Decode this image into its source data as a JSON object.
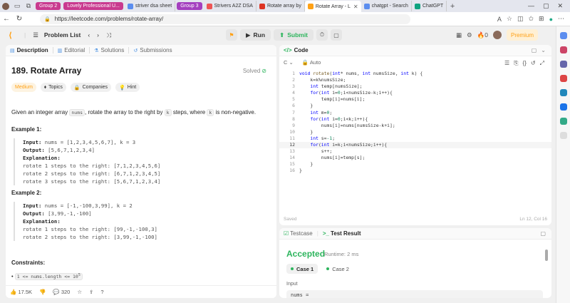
{
  "browser": {
    "tabs": [
      {
        "kind": "group",
        "label": "Group 2",
        "color": "#c93a8f"
      },
      {
        "kind": "group",
        "label": "Lovely Professional U...",
        "color": "#c93a8f"
      },
      {
        "kind": "tab",
        "label": "striver dsa sheet",
        "fav": "#5b8def"
      },
      {
        "kind": "group",
        "label": "Group 3",
        "color": "#a43fbf"
      },
      {
        "kind": "tab",
        "label": "Strivers A2Z DSA",
        "fav": "#e55"
      },
      {
        "kind": "tab",
        "label": "Rotate array by",
        "fav": "#d32"
      },
      {
        "kind": "tab",
        "label": "Rotate Array - L",
        "fav": "#ffa116",
        "active": true
      },
      {
        "kind": "tab",
        "label": "chatgpt - Search",
        "fav": "#5b8def"
      },
      {
        "kind": "tab",
        "label": "ChatGPT",
        "fav": "#10a37f"
      }
    ],
    "new_tab": "+",
    "url": "https://leetcode.com/problems/rotate-array/"
  },
  "header": {
    "problem_list": "Problem List",
    "run": "Run",
    "submit": "Submit",
    "streak": "0",
    "premium": "Premium"
  },
  "left": {
    "tabs": [
      "Description",
      "Editorial",
      "Solutions",
      "Submissions"
    ],
    "title": "189. Rotate Array",
    "solved": "Solved",
    "chips": {
      "difficulty": "Medium",
      "topics": "Topics",
      "companies": "Companies",
      "hint": "Hint"
    },
    "desc": {
      "a": "Given an integer array",
      "b": "nums",
      "c": ", rotate the array to the right by",
      "d": "k",
      "e": "steps, where",
      "f": "k",
      "g": "is non-negative."
    },
    "example1": {
      "heading": "Example 1:",
      "input_label": "Input:",
      "input": "nums = [1,2,3,4,5,6,7], k = 3",
      "output_label": "Output:",
      "output": "[5,6,7,1,2,3,4]",
      "explanation_label": "Explanation:",
      "lines": [
        "rotate 1 steps to the right: [7,1,2,3,4,5,6]",
        "rotate 2 steps to the right: [6,7,1,2,3,4,5]",
        "rotate 3 steps to the right: [5,6,7,1,2,3,4]"
      ]
    },
    "example2": {
      "heading": "Example 2:",
      "input_label": "Input:",
      "input": "nums = [-1,-100,3,99], k = 2",
      "output_label": "Output:",
      "output": "[3,99,-1,-100]",
      "explanation_label": "Explanation:",
      "lines": [
        "rotate 1 steps to the right: [99,-1,-100,3]",
        "rotate 2 steps to the right: [3,99,-1,-100]"
      ]
    },
    "constraints_heading": "Constraints:",
    "constraint1": "1 <= nums.length <= 10",
    "constraint1_sup": "5",
    "footer": {
      "likes": "17.5K",
      "comments": "320"
    }
  },
  "code": {
    "title": "Code",
    "language": "C",
    "mode": "Auto",
    "lines": [
      "void rotate(int* nums, int numsSize, int k) {",
      "    k=k%numsSize;",
      "    int temp[numsSize];",
      "    for(int i=0;i<numsSize-k;i++){",
      "        temp[i]=nums[i];",
      "    }",
      "    int m=0;",
      "    for(int i=0;i<k;i++){",
      "        nums[i]=nums[numsSize-k+i];",
      "    }",
      "    int s=-1;",
      "    for(int i=k;i<numsSize;i++){",
      "        s++;",
      "        nums[i]=temp[s];",
      "    }",
      "}"
    ],
    "current_line": 12,
    "saved": "Saved",
    "position": "Ln 12, Col 16"
  },
  "result": {
    "tab_testcase": "Testcase",
    "tab_result": "Test Result",
    "status": "Accepted",
    "runtime": "Runtime: 2 ms",
    "cases": [
      "Case 1",
      "Case 2"
    ],
    "input_label": "Input",
    "input_value": "nums ="
  },
  "colors": {
    "brand": "#ffa116",
    "accepted": "#2db55d"
  }
}
